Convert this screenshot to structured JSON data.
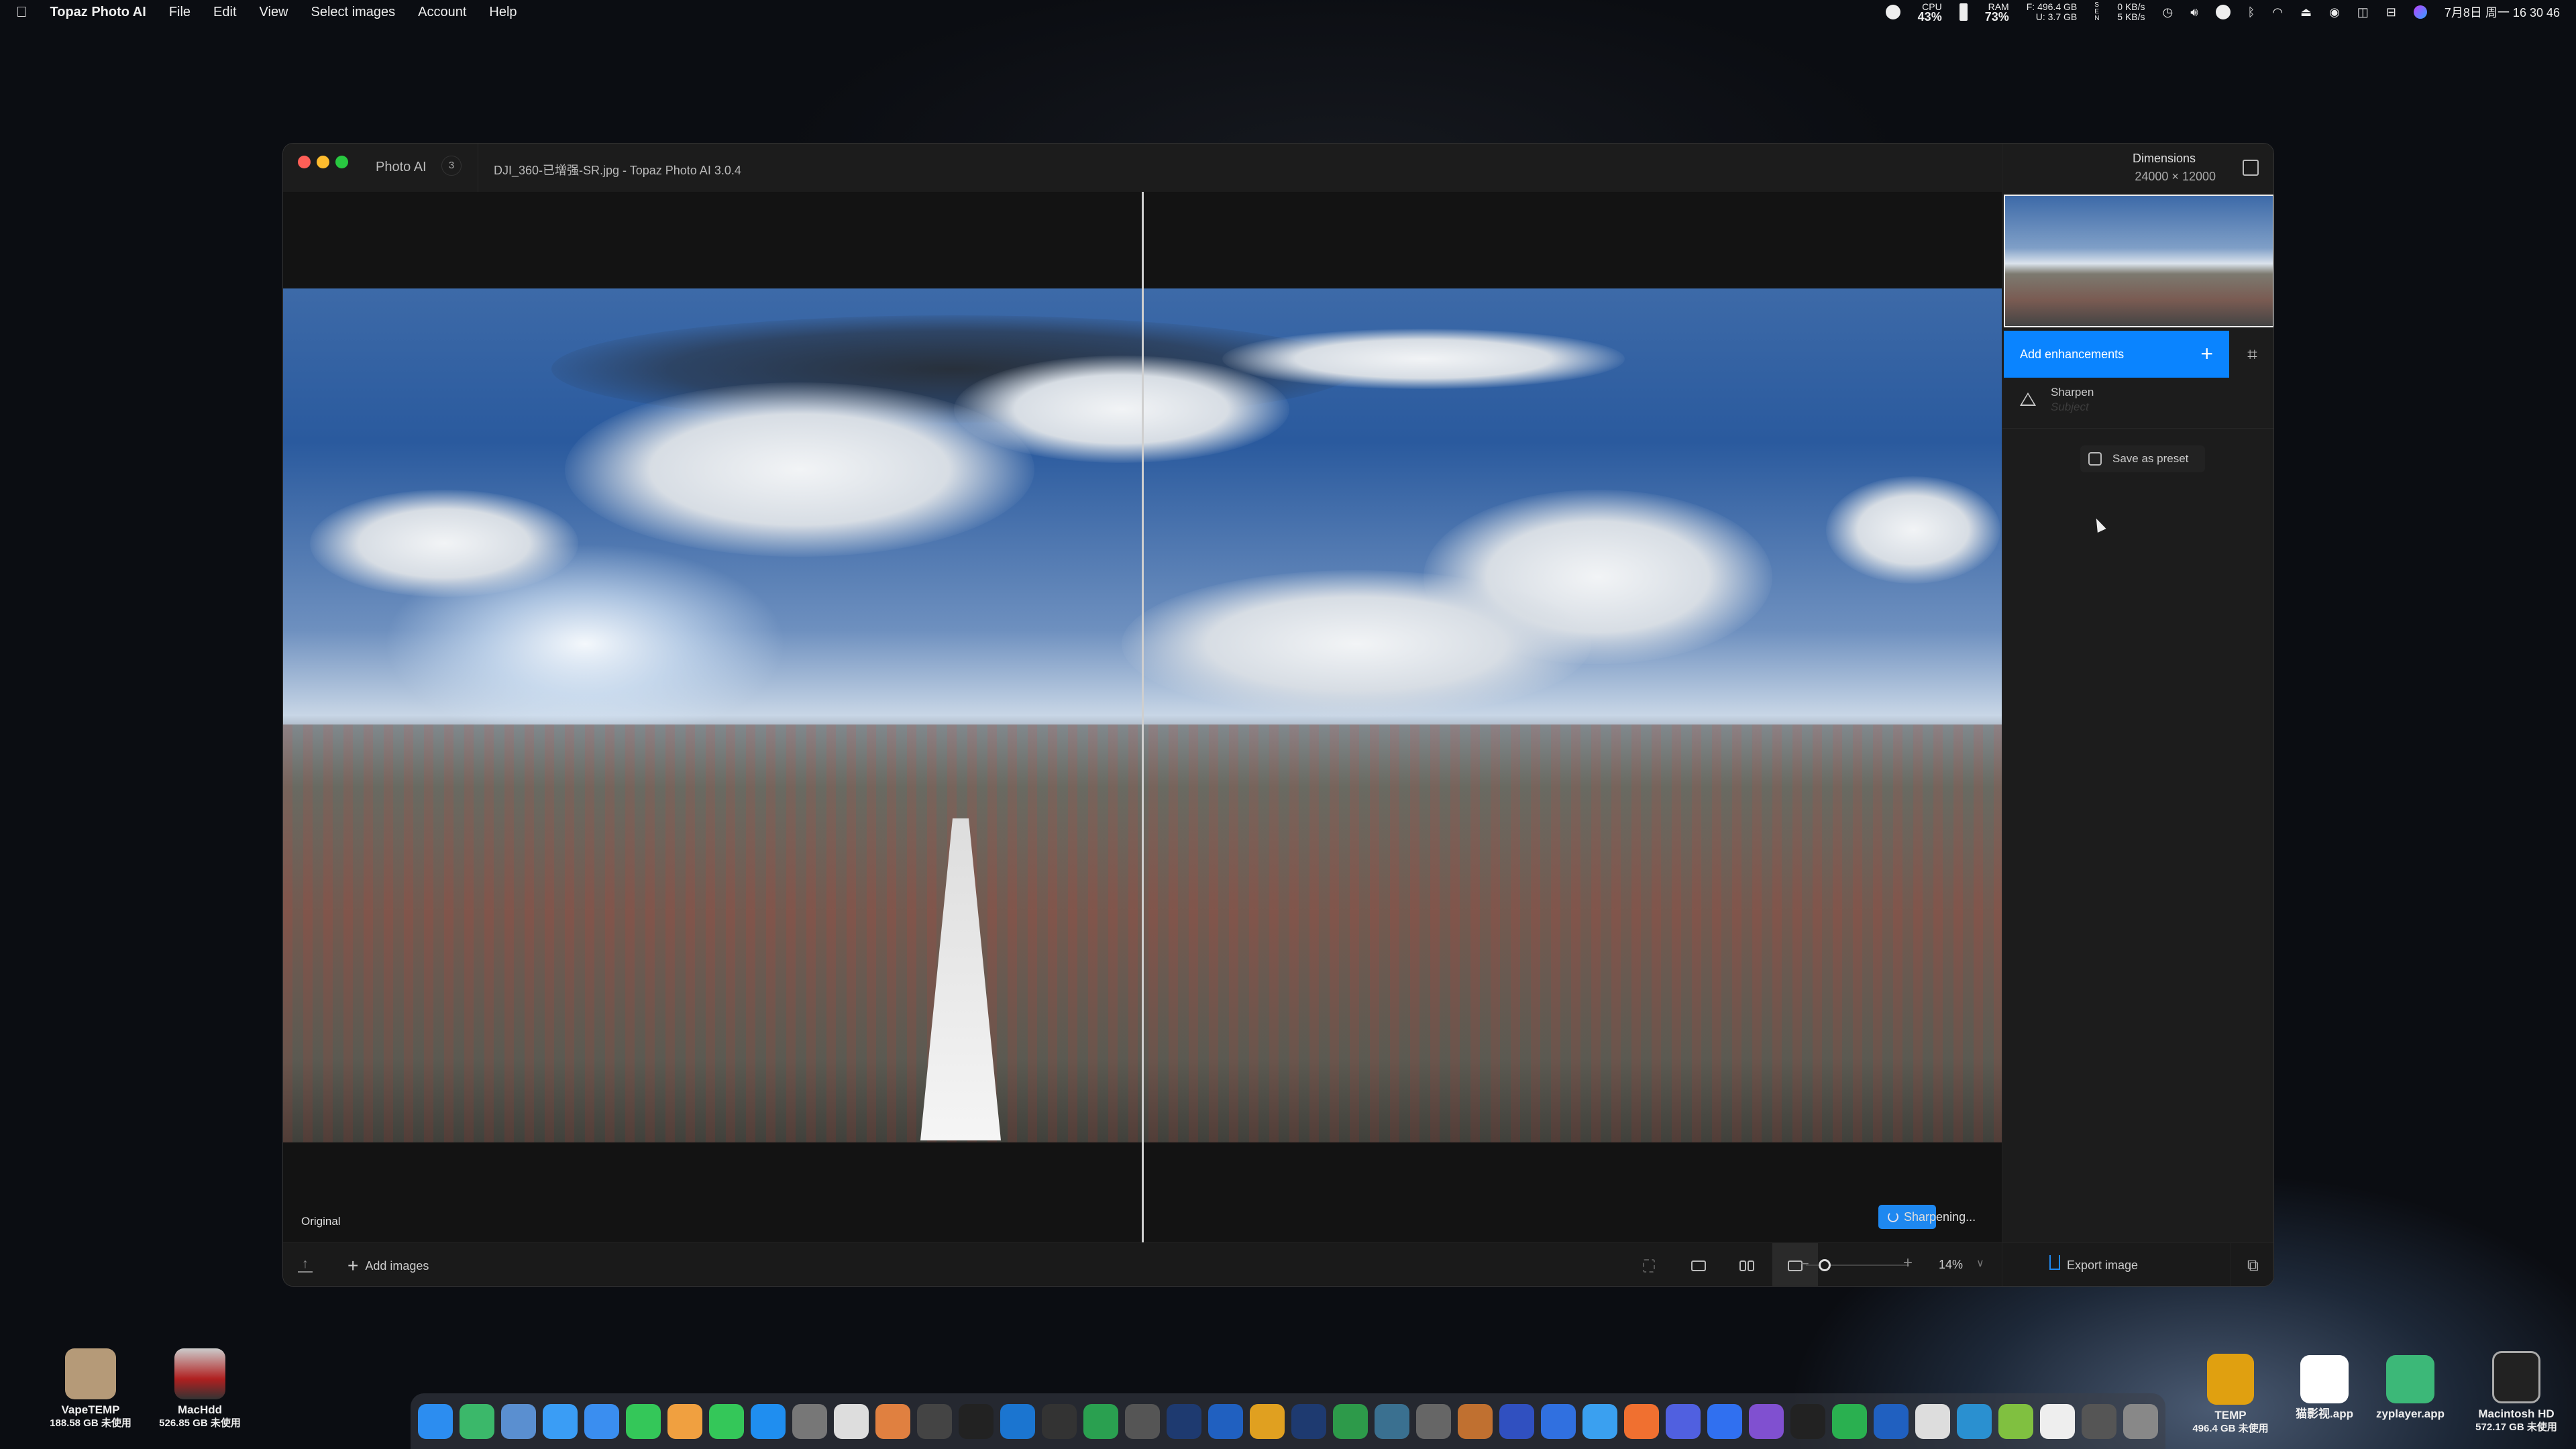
{
  "menubar": {
    "apple_icon": "apple-logo",
    "app_name": "Topaz Photo AI",
    "items": [
      "File",
      "Edit",
      "View",
      "Select images",
      "Account",
      "Help"
    ],
    "status": {
      "cpu_label": "CPU",
      "cpu_value": "43%",
      "ram_label": "RAM",
      "ram_value": "73%",
      "disk_f": "F:  496.4 GB",
      "disk_u": "U:     3.7 GB",
      "sen": "S E N",
      "net_down": "0 KB/s",
      "net_up": "5 KB/s",
      "datetime": "7月8日 周一  16 30 46"
    }
  },
  "window": {
    "tab_label": "Photo AI",
    "tab_count": "3",
    "document_title": "DJI_360-已增强-SR.jpg - Topaz Photo AI 3.0.4",
    "traffic_lights": {
      "close": "#ff5f57",
      "minimize": "#febc2e",
      "zoom": "#28c840"
    }
  },
  "canvas": {
    "original_label": "Original",
    "processing_status": "Sharpening..."
  },
  "panel": {
    "dimensions_label": "Dimensions",
    "dimensions_value": "24000 × 12000",
    "add_enhancements": "Add enhancements",
    "enhancements": [
      {
        "title": "Sharpen",
        "subtitle": "Subject"
      }
    ],
    "save_preset": "Save as preset",
    "accent": "#0a84ff"
  },
  "bottombar": {
    "add_images": "Add images",
    "zoom_value": "14%",
    "zoom_level": 0.14,
    "export": "Export image"
  },
  "desktop": {
    "left_icons": [
      {
        "name": "VapeTEMP",
        "info": "188.58 GB 未使用"
      },
      {
        "name": "MacHdd",
        "info": "526.85 GB 未使用"
      }
    ],
    "right_icons": [
      {
        "name": "TEMP",
        "info": "496.4 GB 未使用"
      },
      {
        "name": "猫影视.app",
        "info": ""
      },
      {
        "name": "zyplayer.app",
        "info": ""
      },
      {
        "name": "Macintosh HD",
        "info": "572.17 GB 未使用"
      }
    ]
  },
  "dock": {
    "apps": [
      "finder",
      "qq-music",
      "safari-like",
      "safari",
      "mail",
      "messages",
      "photos",
      "facetime",
      "app-store",
      "system-settings",
      "calculator",
      "pages",
      "final-cut",
      "capcut",
      "xcode",
      "launcher",
      "numbers",
      "camera",
      "photoshop",
      "crop-tool",
      "sparkle",
      "lightroom",
      "dashboard",
      "network",
      "archive",
      "photo-viewer",
      "123",
      "baidu-cloud",
      "ali-drive",
      "office-orange",
      "circle-app",
      "lark",
      "notes-purple",
      "qq",
      "wechat",
      "word",
      "pen",
      "edge",
      "android",
      "text",
      "utility",
      "trash"
    ]
  }
}
